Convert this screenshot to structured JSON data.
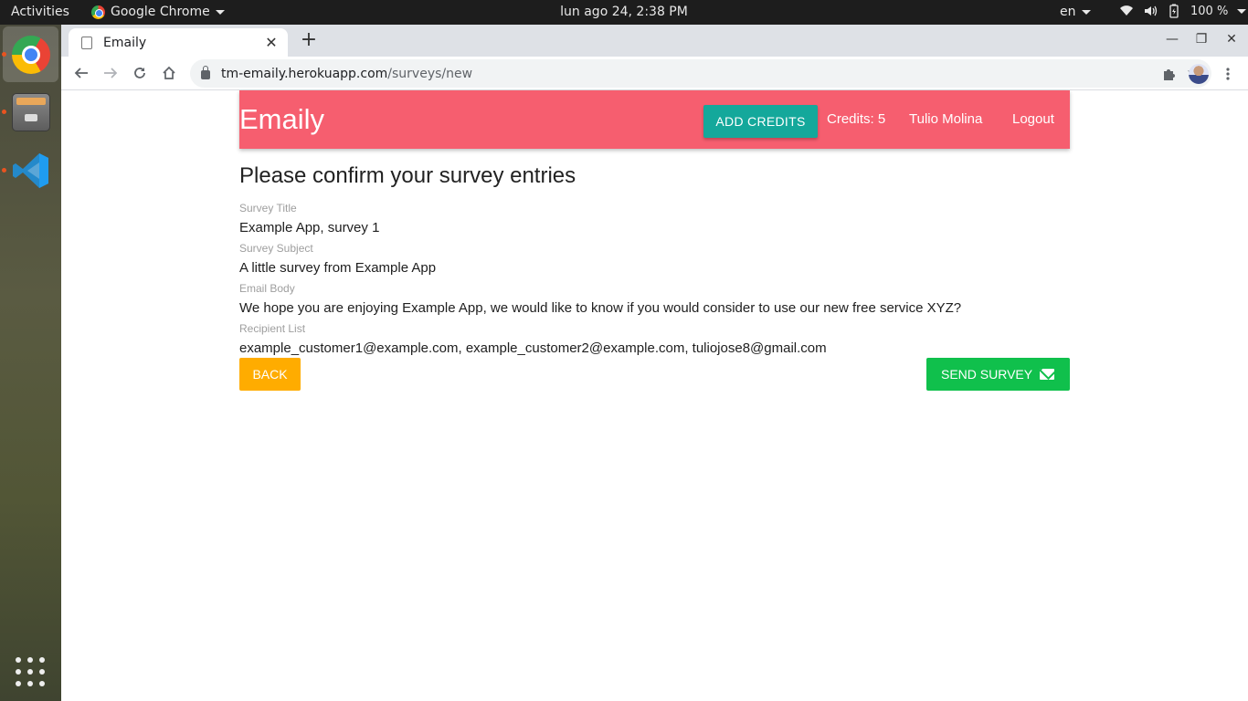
{
  "system_bar": {
    "activities": "Activities",
    "app_name": "Google Chrome",
    "clock": "lun ago 24,  2:38 PM",
    "language": "en",
    "battery": "100 %"
  },
  "dock": {
    "items": [
      "chrome-icon",
      "files-icon",
      "vscode-icon",
      "show-applications-icon"
    ]
  },
  "browser": {
    "tab_title": "Emaily",
    "tab_close": "✕",
    "new_tab": "+",
    "url_host": "tm-emaily.herokuapp.com",
    "url_path": "/surveys/new",
    "window_controls": {
      "minimize": "—",
      "restore": "❐",
      "close": "✕"
    }
  },
  "header": {
    "brand": "Emaily",
    "add_credits": "ADD CREDITS",
    "credits": "Credits: 5",
    "user_name": "Tulio Molina",
    "logout": "Logout",
    "color": "#f65e6f"
  },
  "review": {
    "heading": "Please confirm your survey entries",
    "fields": [
      {
        "label": "Survey Title",
        "value": "Example App, survey 1"
      },
      {
        "label": "Survey Subject",
        "value": "A little survey from Example App"
      },
      {
        "label": "Email Body",
        "value": "We hope you are enjoying Example App, we would like to know if you would consider to use our new free service XYZ?"
      },
      {
        "label": "Recipient List",
        "value": "example_customer1@example.com, example_customer2@example.com, tuliojose8@gmail.com"
      }
    ],
    "back_label": "BACK",
    "send_label": "SEND SURVEY"
  }
}
